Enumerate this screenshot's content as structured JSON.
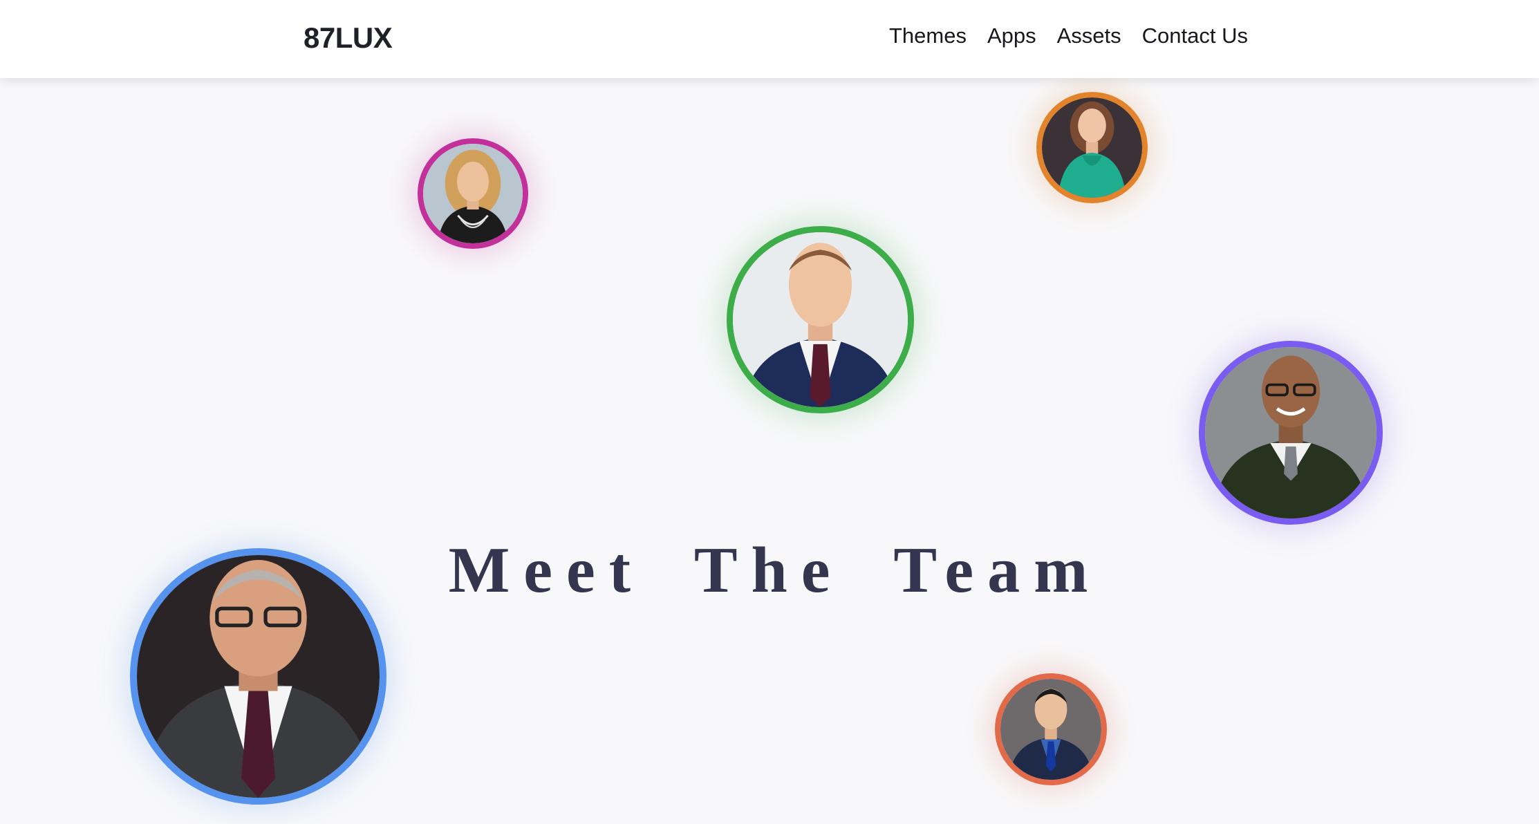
{
  "header": {
    "logo": "87LUX",
    "nav": [
      {
        "label": "Themes"
      },
      {
        "label": "Apps"
      },
      {
        "label": "Assets"
      },
      {
        "label": "Contact Us"
      }
    ]
  },
  "hero": {
    "title": "Meet The Team"
  },
  "team_avatars": [
    {
      "name": "avatar-woman-gold-hair",
      "ring_color": "#c2319a"
    },
    {
      "name": "avatar-woman-teal-top",
      "ring_color": "#e3832c"
    },
    {
      "name": "avatar-man-navy-suit",
      "ring_color": "#3dad4a"
    },
    {
      "name": "avatar-man-green-sweater",
      "ring_color": "#7b5cf0"
    },
    {
      "name": "avatar-man-grey-suit",
      "ring_color": "#5593ef"
    },
    {
      "name": "avatar-man-blue-tie",
      "ring_color": "#e26a48"
    }
  ],
  "colors": {
    "background": "#f8f8fa",
    "navbar": "#ffffff",
    "heading": "#343650",
    "text": "#16181d"
  }
}
